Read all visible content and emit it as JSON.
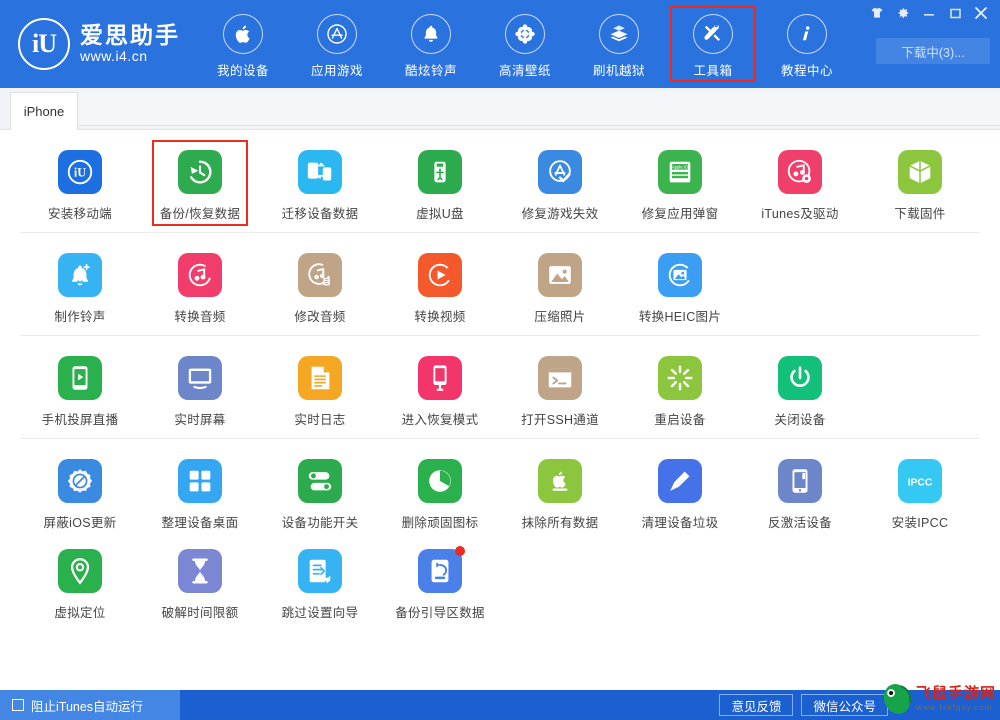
{
  "brand": {
    "logo_text": "iU",
    "name": "爱思助手",
    "url": "www.i4.cn"
  },
  "nav": {
    "items": [
      {
        "label": "我的设备",
        "icon": "apple-icon",
        "active": false
      },
      {
        "label": "应用游戏",
        "icon": "appstore-icon",
        "active": false
      },
      {
        "label": "酷炫铃声",
        "icon": "bell-icon",
        "active": false
      },
      {
        "label": "高清壁纸",
        "icon": "flower-wallpaper-icon",
        "active": false
      },
      {
        "label": "刷机越狱",
        "icon": "cydia-box-icon",
        "active": false
      },
      {
        "label": "工具箱",
        "icon": "toolbox-wrench-icon",
        "active": true
      },
      {
        "label": "教程中心",
        "icon": "info-icon",
        "active": false
      }
    ]
  },
  "window_controls": {
    "skin": "tshirt-icon",
    "settings": "gear-icon",
    "minimize": "minimize-icon",
    "maximize": "maximize-icon",
    "close": "close-icon"
  },
  "download_button": {
    "label": "下载中(3)..."
  },
  "tabs": {
    "items": [
      {
        "label": "iPhone",
        "active": true
      }
    ]
  },
  "tool_rows": [
    {
      "tools": [
        {
          "label": "安装移动端",
          "icon": "i4-app-icon",
          "bg": "#1b6fe0",
          "selected": false
        },
        {
          "label": "备份/恢复数据",
          "icon": "backup-restore-icon",
          "bg": "#2eab4f",
          "selected": true
        },
        {
          "label": "迁移设备数据",
          "icon": "device-migrate-icon",
          "bg": "#2bb7ef",
          "selected": false
        },
        {
          "label": "虚拟U盘",
          "icon": "usb-drive-icon",
          "bg": "#2bab4e",
          "selected": false
        },
        {
          "label": "修复游戏失效",
          "icon": "appstore-fix-icon",
          "bg": "#3b8ae2",
          "selected": false
        },
        {
          "label": "修复应用弹窗",
          "icon": "appleid-card-icon",
          "bg": "#3bb34f",
          "selected": false
        },
        {
          "label": "iTunes及驱动",
          "icon": "itunes-gear-icon",
          "bg": "#ef3f6a",
          "selected": false
        },
        {
          "label": "下载固件",
          "icon": "firmware-cube-icon",
          "bg": "#8cc63e",
          "selected": false
        }
      ]
    },
    {
      "tools": [
        {
          "label": "制作铃声",
          "icon": "ringtone-bell-icon",
          "bg": "#35b3f2",
          "selected": false
        },
        {
          "label": "转换音频",
          "icon": "audio-convert-icon",
          "bg": "#f13d6c",
          "selected": false
        },
        {
          "label": "修改音频",
          "icon": "audio-edit-icon",
          "bg": "#bfa487",
          "selected": false
        },
        {
          "label": "转换视频",
          "icon": "video-convert-icon",
          "bg": "#f4592c",
          "selected": false
        },
        {
          "label": "压缩照片",
          "icon": "photo-compress-icon",
          "bg": "#bfa487",
          "selected": false
        },
        {
          "label": "转换HEIC图片",
          "icon": "heic-convert-icon",
          "bg": "#3b9ef2",
          "selected": false
        }
      ]
    },
    {
      "tools": [
        {
          "label": "手机投屏直播",
          "icon": "screen-cast-icon",
          "bg": "#2bb04e",
          "selected": false
        },
        {
          "label": "实时屏幕",
          "icon": "realtime-screen-icon",
          "bg": "#6c86c9",
          "selected": false
        },
        {
          "label": "实时日志",
          "icon": "log-document-icon",
          "bg": "#f5a623",
          "selected": false
        },
        {
          "label": "进入恢复模式",
          "icon": "recovery-mode-icon",
          "bg": "#f2366b",
          "selected": false
        },
        {
          "label": "打开SSH通道",
          "icon": "ssh-terminal-icon",
          "bg": "#bfa487",
          "selected": false
        },
        {
          "label": "重启设备",
          "icon": "restart-device-icon",
          "bg": "#8cc63e",
          "selected": false
        },
        {
          "label": "关闭设备",
          "icon": "power-off-icon",
          "bg": "#12c07a",
          "selected": false
        }
      ]
    },
    {
      "tools": [
        {
          "label": "屏蔽iOS更新",
          "icon": "block-update-icon",
          "bg": "#3b8ae2",
          "selected": false
        },
        {
          "label": "整理设备桌面",
          "icon": "organize-home-icon",
          "bg": "#35a7f2",
          "selected": false
        },
        {
          "label": "设备功能开关",
          "icon": "feature-toggle-icon",
          "bg": "#2bab4e",
          "selected": false
        },
        {
          "label": "删除顽固图标",
          "icon": "remove-icon-icon",
          "bg": "#2bb04e",
          "selected": false
        },
        {
          "label": "抹除所有数据",
          "icon": "erase-data-icon",
          "bg": "#8cc63e",
          "selected": false
        },
        {
          "label": "清理设备垃圾",
          "icon": "clean-junk-icon",
          "bg": "#4572e8",
          "selected": false
        },
        {
          "label": "反激活设备",
          "icon": "deactivate-icon",
          "bg": "#6c86c9",
          "selected": false
        },
        {
          "label": "安装IPCC",
          "icon": "ipcc-icon",
          "bg": "#35c8f2",
          "selected": false
        },
        {
          "label": "虚拟定位",
          "icon": "virtual-location-icon",
          "bg": "#2bb04e",
          "selected": false
        },
        {
          "label": "破解时间限额",
          "icon": "hourglass-icon",
          "bg": "#7b86d4",
          "selected": false
        },
        {
          "label": "跳过设置向导",
          "icon": "skip-setup-icon",
          "bg": "#35b3f2",
          "selected": false
        },
        {
          "label": "备份引导区数据",
          "icon": "backup-boot-icon",
          "bg": "#4a80e8",
          "selected": false,
          "badge": true
        }
      ]
    }
  ],
  "footer": {
    "checkbox_label": "阻止iTunes自动运行",
    "checked": false,
    "buttons": [
      {
        "label": "意见反馈"
      },
      {
        "label": "微信公众号"
      }
    ],
    "watermark": {
      "title": "飞鼠手游网",
      "url": "www.fskfgsy.com"
    }
  },
  "colors": {
    "header_blue": "#2a72dd",
    "footer_blue": "#1c5fd0",
    "highlight_red": "#ee2b21",
    "accent": "#4486e4"
  }
}
